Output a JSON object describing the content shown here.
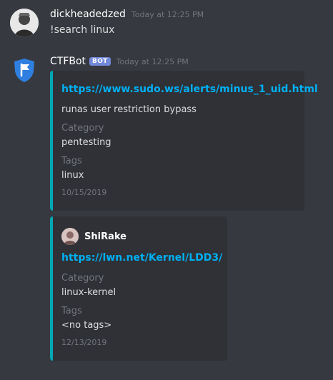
{
  "messages": [
    {
      "username": "dickheadedzed",
      "timestamp": "Today at 12:25 PM",
      "text": "!search linux"
    },
    {
      "username": "CTFBot",
      "badge": "BOT",
      "timestamp": "Today at 12:25 PM",
      "embeds": [
        {
          "title": "https://www.sudo.ws/alerts/minus_1_uid.html",
          "description": "runas user restriction bypass",
          "fields": [
            {
              "name": "Category",
              "value": "pentesting"
            },
            {
              "name": "Tags",
              "value": "linux"
            }
          ],
          "footer": "10/15/2019"
        },
        {
          "author": "ShiRake",
          "title": "https://lwn.net/Kernel/LDD3/",
          "fields": [
            {
              "name": "Category",
              "value": "linux-kernel"
            },
            {
              "name": "Tags",
              "value": "<no tags>"
            }
          ],
          "footer": "12/13/2019"
        }
      ]
    }
  ],
  "colors": {
    "background": "#36393f",
    "embed_background": "#2f3136",
    "embed_accent": "#00a8b5",
    "link": "#00b0f4",
    "bot_badge": "#7289da",
    "bot_shield": "#2f7fe0"
  },
  "icons": {
    "user_avatar": "user-avatar-image",
    "bot_avatar": "shield-flag-icon",
    "author_avatar": "author-avatar-image"
  }
}
